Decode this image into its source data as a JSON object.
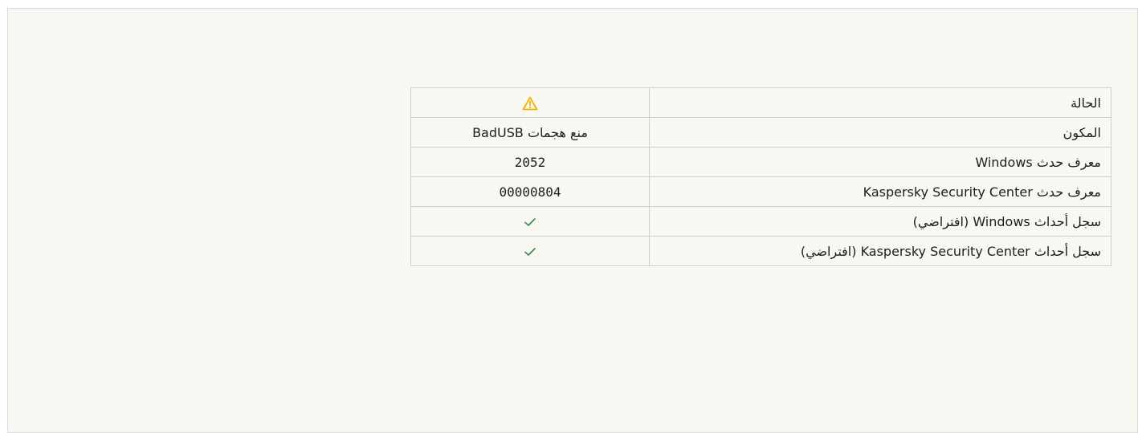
{
  "colors": {
    "panel_background": "#f8f7f1",
    "border": "#cfcfcf",
    "warning": "#f0b400",
    "check": "#2e8b57"
  },
  "rows": [
    {
      "label": "الحالة",
      "value_icon": "warning-icon"
    },
    {
      "label": "المكون",
      "value": "منع هجمات BadUSB"
    },
    {
      "label": "معرف حدث Windows",
      "value": "2052"
    },
    {
      "label": "معرف حدث Kaspersky Security Center",
      "value": "00000804"
    },
    {
      "label": "سجل أحداث Windows (افتراضي)",
      "value_icon": "checkmark-icon"
    },
    {
      "label": "سجل أحداث Kaspersky Security Center (افتراضي)",
      "value_icon": "checkmark-icon"
    }
  ]
}
